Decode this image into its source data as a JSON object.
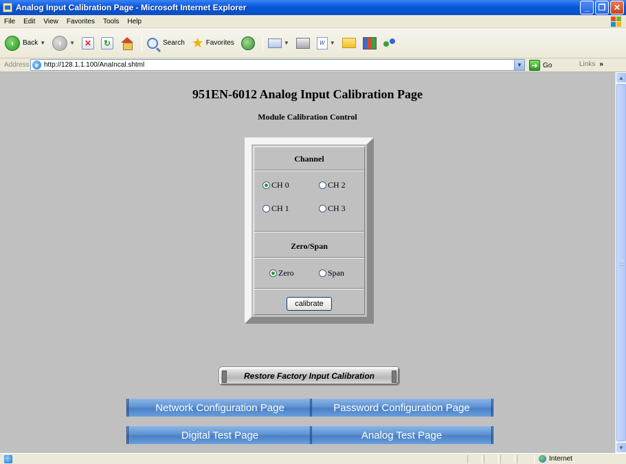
{
  "window": {
    "title": "Analog Input Calibration Page - Microsoft Internet Explorer"
  },
  "menu": [
    "File",
    "Edit",
    "View",
    "Favorites",
    "Tools",
    "Help"
  ],
  "toolbar": {
    "back_label": "Back",
    "search_label": "Search",
    "favorites_label": "Favorites"
  },
  "address": {
    "label": "Address",
    "url": "http://128.1.1.100/AnaIncal.shtml",
    "go_label": "Go",
    "links_label": "Links"
  },
  "page": {
    "title": "951EN-6012 Analog Input Calibration Page",
    "subtitle": "Module Calibration Control",
    "channel_header": "Channel",
    "channels": [
      {
        "label": "CH  0",
        "selected": true
      },
      {
        "label": "CH  2",
        "selected": false
      },
      {
        "label": "CH  1",
        "selected": false
      },
      {
        "label": "CH  3",
        "selected": false
      }
    ],
    "zerospan_header": "Zero/Span",
    "modes": [
      {
        "label": "Zero",
        "selected": true
      },
      {
        "label": "Span",
        "selected": false
      }
    ],
    "calibrate_label": "calibrate",
    "restore_label": "Restore Factory Input Calibration",
    "nav": {
      "network": "Network Configuration Page",
      "password": "Password Configuration Page",
      "digital": "Digital Test Page",
      "analog": "Analog Test Page"
    }
  },
  "status": {
    "zone": "Internet"
  }
}
